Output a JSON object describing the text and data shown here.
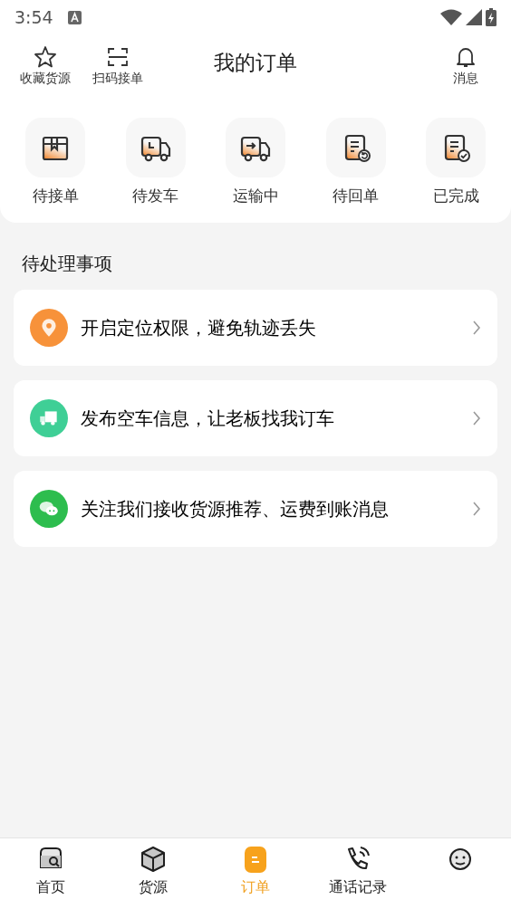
{
  "status_bar": {
    "time": "3:54"
  },
  "header": {
    "title": "我的订单",
    "left_actions": [
      {
        "kind": "star",
        "label": "收藏货源"
      },
      {
        "kind": "scan",
        "label": "扫码接单"
      }
    ],
    "right_action": {
      "kind": "bell",
      "label": "消息"
    }
  },
  "order_states": [
    {
      "kind": "box",
      "label": "待接单"
    },
    {
      "kind": "clock-truck",
      "label": "待发车"
    },
    {
      "kind": "arrow-truck",
      "label": "运输中"
    },
    {
      "kind": "doc-return",
      "label": "待回单"
    },
    {
      "kind": "doc-check",
      "label": "已完成"
    }
  ],
  "todo": {
    "title": "待处理事项",
    "items": [
      {
        "kind": "location",
        "color": "#f7923a",
        "text": "开启定位权限，避免轨迹丢失"
      },
      {
        "kind": "truck",
        "color": "#3fcf96",
        "text": "发布空车信息，让老板找我订车"
      },
      {
        "kind": "chat",
        "color": "#2dbd4e",
        "text": "关注我们接收货源推荐、运费到账消息"
      }
    ]
  },
  "tabs": [
    {
      "kind": "store",
      "label": "首页",
      "selected": false
    },
    {
      "kind": "cube",
      "label": "货源",
      "selected": false
    },
    {
      "kind": "order",
      "label": "订单",
      "selected": true
    },
    {
      "kind": "phone",
      "label": "通话记录",
      "selected": false
    },
    {
      "kind": "face",
      "selected": false
    }
  ]
}
